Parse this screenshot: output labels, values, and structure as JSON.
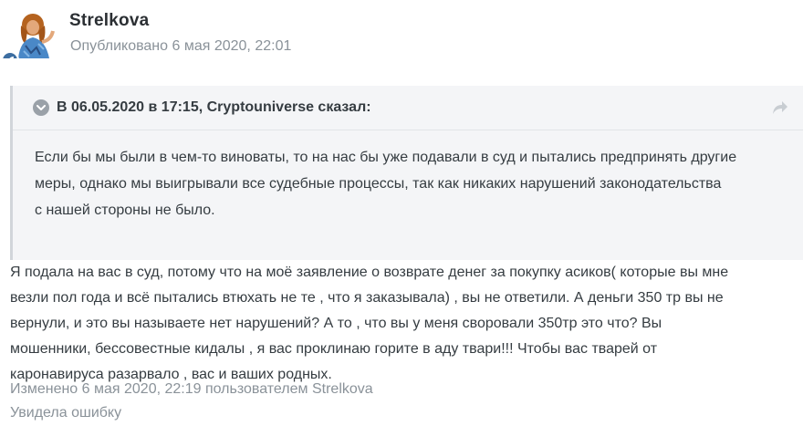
{
  "author": {
    "name": "Strelkova",
    "published": "Опубликовано 6 мая 2020, 22:01"
  },
  "icons": {
    "avatar": "user-avatar",
    "badge": "rocket-icon",
    "toggle": "chevron-down-icon",
    "share": "share-arrow-icon"
  },
  "colors": {
    "badge": "#3d6ea1",
    "quote_bg": "#f4f5f7",
    "muted_text": "#8a9299"
  },
  "quote": {
    "citation": "В 06.05.2020 в 17:15, Cryptouniverse сказал:",
    "lines": [
      "Если бы мы были в чем-то виноваты, то на нас бы уже подавали в суд и пытались предпринять другие",
      "меры, однако мы выигрывали все судебные процессы, так как никаких нарушений законодательства",
      "с нашей стороны не было."
    ]
  },
  "post": {
    "lines": [
      "Я подала на вас в суд, потому что на моё заявление о возврате денег за покупку асиков( которые вы мне",
      "везли пол года и всё пытались втюхать не те , что я заказывала) , вы не ответили. А деньги 350 тр вы не",
      "вернули,  и это вы называете нет нарушений? А то , что вы у меня своровали 350тр это что? Вы",
      "мошенники,  бессовестные кидалы , я вас проклинаю горите в аду твари!!! Чтобы  вас тварей от",
      "каронавируса разарвало , вас и ваших родных."
    ],
    "edited": "Изменено 6 мая 2020, 22:19 пользователем Strelkova",
    "edit_reason": "Увидела ошибку"
  }
}
